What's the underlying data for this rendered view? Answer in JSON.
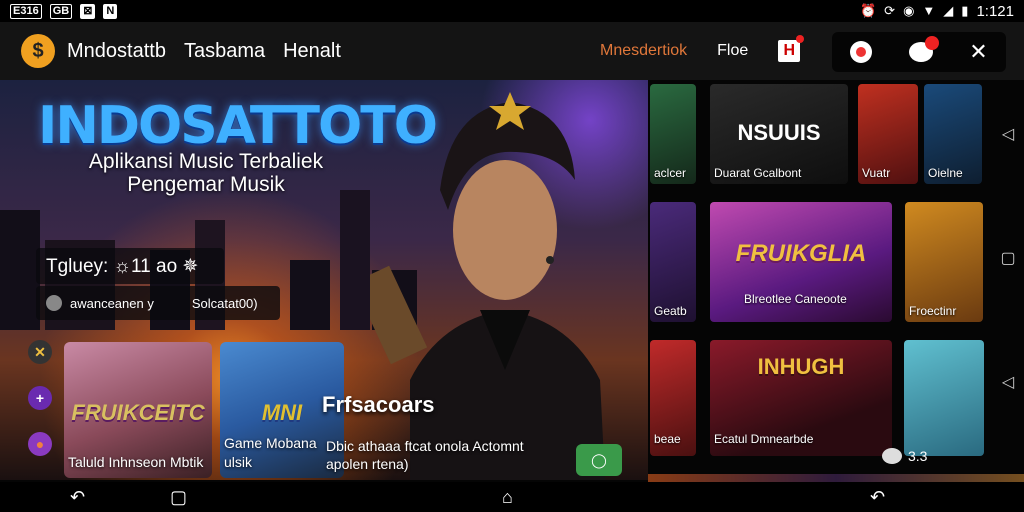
{
  "status_bar": {
    "left_chips": [
      "E316",
      "GB"
    ],
    "time": "1:121"
  },
  "header": {
    "logo_glyph": "$",
    "nav": [
      "Mndostattb",
      "Tasbama",
      "Henalt"
    ],
    "link_orange": "Mnesdertiok",
    "link_white": "Floe",
    "badge_glyph": "H"
  },
  "hero": {
    "title": "INDOSATTOTO",
    "subtitle": "Aplikansi Music Terbaliek Pengemar Musik",
    "promo": "Tgluey: ☼11 ao ✵",
    "promo_info_left": "awanceanen y",
    "promo_info_right": "Solcatat00)",
    "overlay_title": "Frfsacoars",
    "caption": "Dbic athaaa ftcat onola Actomnt apolen rtena)",
    "thumbs": [
      {
        "art": "FRUIKCEITC",
        "caption": "Taluld Inhnseon Mbtik"
      },
      {
        "art": "MNI",
        "caption": "Game Mobana ulsik"
      }
    ]
  },
  "grid": {
    "c1": "aclcer",
    "c2_art": "NSUUIS",
    "c2": "Duarat Gcalbont",
    "c3": "Vuatr",
    "c4": "Oielne",
    "c5": "Geatb",
    "c6_art": "FRUIKGLIA",
    "c6": "Blreotlee Caneoote",
    "c7": "Froectinr",
    "c8": "beae",
    "c9_art": "INHUGH",
    "c9": "Ecatul Dmnearbde",
    "comments": "3.3"
  },
  "colors": {
    "header_bg": "#141414",
    "accent_orange": "#e0773a",
    "title_blue": "#3fb0ff",
    "chat_green": "#3a9a4a"
  },
  "icons": [
    "search-icon",
    "record-icon",
    "chat-icon",
    "close-icon",
    "back-icon",
    "home-icon",
    "recents-icon"
  ]
}
